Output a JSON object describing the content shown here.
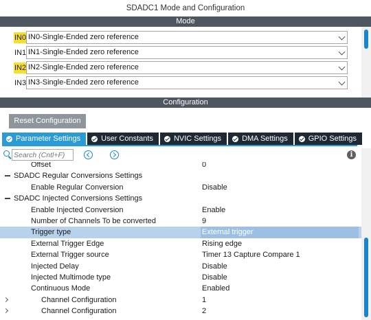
{
  "window": {
    "title": "SDADC1 Mode and Configuration"
  },
  "mode": {
    "header": "Mode",
    "inputs": [
      {
        "label": "IN0",
        "highlighted": true,
        "value": "IN0-Single-Ended zero reference"
      },
      {
        "label": "IN1",
        "highlighted": false,
        "value": "IN1-Single-Ended zero reference"
      },
      {
        "label": "IN2",
        "highlighted": true,
        "value": "IN2-Single-Ended zero reference"
      },
      {
        "label": "IN3",
        "highlighted": false,
        "value": "IN3-Single-Ended zero reference"
      }
    ]
  },
  "configuration": {
    "header": "Configuration",
    "reset_label": "Reset Configuration",
    "tabs": [
      {
        "label": "Parameter Settings",
        "active": true
      },
      {
        "label": "User Constants",
        "active": false
      },
      {
        "label": "NVIC Settings",
        "active": false
      },
      {
        "label": "DMA Settings",
        "active": false
      },
      {
        "label": "GPIO Settings",
        "active": false
      }
    ],
    "search": {
      "placeholder": "Search (Cntl+F)"
    },
    "params": [
      {
        "name": "Offset",
        "value": "0"
      },
      {
        "name": "SDADC Regular Conversions Settings",
        "value": ""
      },
      {
        "name": "Enable Regular Conversion",
        "value": "Disable"
      },
      {
        "name": "SDADC Injected Conversions Settings",
        "value": ""
      },
      {
        "name": "Enable Injected Conversion",
        "value": "Enable"
      },
      {
        "name": "Number of Channels To be converted",
        "value": "9"
      },
      {
        "name": "Trigger type",
        "value": "External trigger"
      },
      {
        "name": "External Trigger Edge",
        "value": "Rising edge"
      },
      {
        "name": "External Trigger source",
        "value": "Timer 13 Capture Compare 1"
      },
      {
        "name": "Injected Delay",
        "value": "Disable"
      },
      {
        "name": "Injected Multimode type",
        "value": "Disable"
      },
      {
        "name": "Continuous Mode",
        "value": "Enabled"
      },
      {
        "name": "Channel Configuration",
        "value": "1"
      },
      {
        "name": "Channel Configuration",
        "value": "2"
      }
    ]
  },
  "colors": {
    "section_header": "#4e5660",
    "tab_active": "#2b9bd8",
    "tab_inactive": "#1f2933",
    "highlight_label": "#f5e12c",
    "selected_row": "#b8d2ec",
    "accent": "#1a86c9"
  }
}
